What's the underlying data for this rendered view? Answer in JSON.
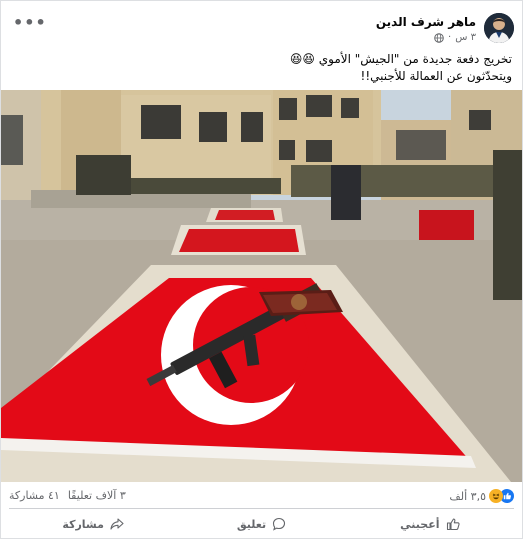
{
  "post": {
    "author": "ماهر شرف الدين",
    "time": "٣ س",
    "more": "•••",
    "text_line1": "تخريج دفعة جديدة من \"الجيش\" الأموي 😆😆",
    "text_line2": "ويتحدّثون عن العمالة للأجنبي!!"
  },
  "stats": {
    "reactions": "٣,٥ ألف",
    "comments": "٣ آلاف تعليقًا",
    "shares": "٤١ مشاركة"
  },
  "actions": {
    "like": "أعجبني",
    "comment": "تعليق",
    "share": "مشاركة"
  },
  "colors": {
    "like_blue": "#1877f2",
    "haha_yellow": "#f7b125",
    "flag_red": "#e30a17"
  }
}
